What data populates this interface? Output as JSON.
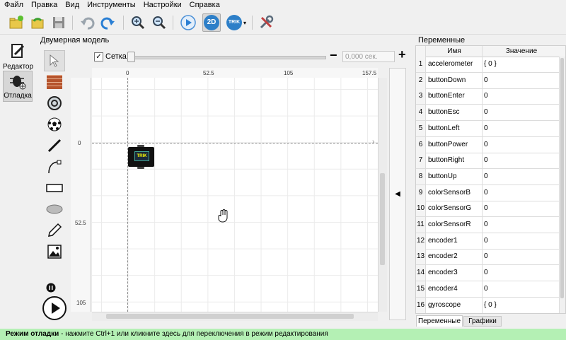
{
  "menu": [
    "Файл",
    "Правка",
    "Вид",
    "Инструменты",
    "Настройки",
    "Справка"
  ],
  "toolbar": {
    "buttons": [
      "new-project-icon",
      "open-icon",
      "save-icon",
      "undo-icon",
      "redo-icon",
      "zoom-in-icon",
      "zoom-out-icon",
      "run-icon",
      "2d-model-icon",
      "trik-icon",
      "settings-icon"
    ],
    "label_2d": "2D",
    "label_trik": "TRIK"
  },
  "modes": {
    "editor": "Редактор",
    "debug": "Отладка"
  },
  "model_panel": {
    "title": "Двумерная модель",
    "grid_label": "Сетка",
    "grid_checked": true,
    "time_value": "0,000 сек.",
    "minus": "−",
    "plus": "+"
  },
  "palette": [
    "cursor-icon",
    "wall-icon",
    "skittle-icon",
    "ball-icon",
    "line-icon",
    "bezier-icon",
    "rectangle-icon",
    "ellipse-icon",
    "pencil-icon",
    "image-icon"
  ],
  "ruler": {
    "top": [
      "0",
      "52.5",
      "105",
      "157.5"
    ],
    "left": [
      "0",
      "52.5",
      "105"
    ]
  },
  "robot": {
    "label": "TRIK"
  },
  "variables": {
    "title": "Переменные",
    "col_name": "Имя",
    "col_value": "Значение",
    "rows": [
      {
        "n": "1",
        "name": "accelerometer",
        "value": "{ 0 }"
      },
      {
        "n": "2",
        "name": "buttonDown",
        "value": "0"
      },
      {
        "n": "3",
        "name": "buttonEnter",
        "value": "0"
      },
      {
        "n": "4",
        "name": "buttonEsc",
        "value": "0"
      },
      {
        "n": "5",
        "name": "buttonLeft",
        "value": "0"
      },
      {
        "n": "6",
        "name": "buttonPower",
        "value": "0"
      },
      {
        "n": "7",
        "name": "buttonRight",
        "value": "0"
      },
      {
        "n": "8",
        "name": "buttonUp",
        "value": "0"
      },
      {
        "n": "9",
        "name": "colorSensorB",
        "value": "0"
      },
      {
        "n": "10",
        "name": "colorSensorG",
        "value": "0"
      },
      {
        "n": "11",
        "name": "colorSensorR",
        "value": "0"
      },
      {
        "n": "12",
        "name": "encoder1",
        "value": "0"
      },
      {
        "n": "13",
        "name": "encoder2",
        "value": "0"
      },
      {
        "n": "14",
        "name": "encoder3",
        "value": "0"
      },
      {
        "n": "15",
        "name": "encoder4",
        "value": "0"
      },
      {
        "n": "16",
        "name": "gyroscope",
        "value": "{ 0 }"
      }
    ],
    "tabs": [
      "Переменные",
      "Графики"
    ]
  },
  "status": {
    "bold": "Режим отладки",
    "text": " - нажмите Ctrl+1 или кликните здесь для переключения в режим редактирования"
  },
  "colors": {
    "status_bg": "#b4f0b4",
    "accent": "#2a7fd4"
  }
}
